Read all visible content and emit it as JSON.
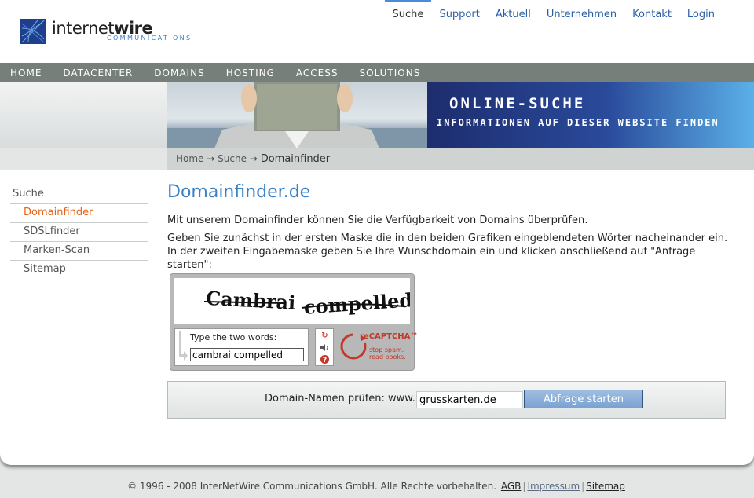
{
  "brand": {
    "name_light": "internet",
    "name_bold": "wire",
    "subtitle": "COMMUNICATIONS"
  },
  "topnav": [
    {
      "label": "Suche",
      "active": true
    },
    {
      "label": "Support"
    },
    {
      "label": "Aktuell"
    },
    {
      "label": "Unternehmen"
    },
    {
      "label": "Kontakt"
    },
    {
      "label": "Login"
    }
  ],
  "mainnav": [
    "HOME",
    "DATACENTER",
    "DOMAINS",
    "HOSTING",
    "ACCESS",
    "SOLUTIONS"
  ],
  "banner": {
    "title": "ONLINE-SUCHE",
    "subtitle": "INFORMATIONEN AUF DIESER WEBSITE FINDEN"
  },
  "breadcrumb": {
    "items": [
      "Home",
      "Suche"
    ],
    "current": "Domainfinder",
    "separator": "→"
  },
  "sidebar": {
    "root": "Suche",
    "items": [
      {
        "label": "Domainfinder",
        "active": true
      },
      {
        "label": "SDSLfinder"
      },
      {
        "label": "Marken-Scan"
      },
      {
        "label": "Sitemap"
      }
    ]
  },
  "content": {
    "heading": "Domainfinder.de",
    "intro": "Mit unserem Domainfinder können Sie die Verfügbarkeit von Domains überprüfen.",
    "instructions": "Geben Sie zunächst in der ersten Maske die in den beiden Grafiken eingeblendeten Wörter nacheinander ein. In der zweiten Eingabemaske geben Sie Ihre Wunschdomain ein und klicken anschließend auf \"Anfrage starten\":"
  },
  "captcha": {
    "word1": "Cambrai",
    "word2": "compelled",
    "prompt": "Type the two words:",
    "value": "cambrai compelled",
    "brand_re": "re",
    "brand": "CAPTCHA",
    "tm": "™",
    "tagline1": "stop spam.",
    "tagline2": "read books.",
    "icons": [
      "refresh-icon",
      "audio-icon",
      "help-icon"
    ]
  },
  "domain_check": {
    "label": "Domain-Namen prüfen: www.",
    "value": "grusskarten.de",
    "button": "Abfrage starten"
  },
  "footer": {
    "copyright": "© 1996 - 2008 InterNetWire Communications GmbH. Alle Rechte vorbehalten.",
    "links": [
      "AGB",
      "Impressum",
      "Sitemap"
    ]
  },
  "colors": {
    "nav_bg": "#777f7b",
    "accent_blue": "#3a82c8",
    "active_orange": "#e3641c",
    "banner_blue": "#2a4a9b"
  }
}
